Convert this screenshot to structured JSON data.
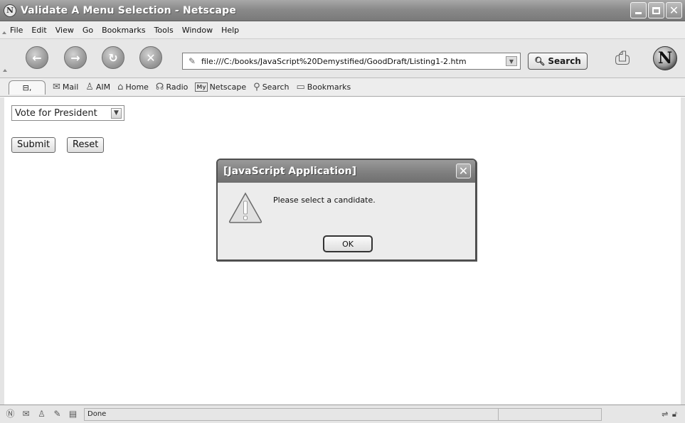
{
  "window": {
    "title": "Validate A Menu Selection - Netscape",
    "app_icon": "netscape-icon"
  },
  "menubar": {
    "items": [
      {
        "label": "File"
      },
      {
        "label": "Edit"
      },
      {
        "label": "View"
      },
      {
        "label": "Go"
      },
      {
        "label": "Bookmarks"
      },
      {
        "label": "Tools"
      },
      {
        "label": "Window"
      },
      {
        "label": "Help"
      }
    ]
  },
  "navbar": {
    "buttons": [
      "back",
      "forward",
      "reload",
      "stop"
    ],
    "url": "file:///C:/books/JavaScript%20Demystified/GoodDraft/Listing1-2.htm",
    "search_label": "Search"
  },
  "personal_toolbar": {
    "items": [
      {
        "label": "Mail",
        "icon": "mail-icon"
      },
      {
        "label": "AIM",
        "icon": "aim-icon"
      },
      {
        "label": "Home",
        "icon": "home-icon"
      },
      {
        "label": "Radio",
        "icon": "radio-icon"
      },
      {
        "label": "Netscape",
        "icon": "my-netscape-icon",
        "icon_text": "My"
      },
      {
        "label": "Search",
        "icon": "search-icon"
      },
      {
        "label": "Bookmarks",
        "icon": "bookmarks-icon"
      }
    ]
  },
  "page": {
    "select_value": "Vote for President",
    "submit_label": "Submit",
    "reset_label": "Reset"
  },
  "dialog": {
    "title": "[JavaScript Application]",
    "message": "Please select a candidate.",
    "ok_label": "OK"
  },
  "statusbar": {
    "status_text": "Done"
  }
}
